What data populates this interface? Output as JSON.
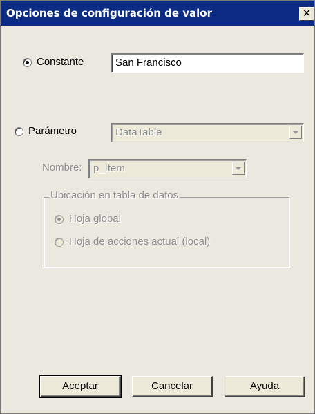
{
  "window": {
    "title": "Opciones de configuración de valor",
    "close_glyph": "✕"
  },
  "constant": {
    "label": "Constante",
    "selected": true,
    "value": "San Francisco"
  },
  "parameter": {
    "label": "Parámetro",
    "selected": false,
    "type_value": "DataTable",
    "name_label": "Nombre:",
    "name_value": "p_Item"
  },
  "location": {
    "legend": "Ubicación en tabla de datos",
    "options": [
      {
        "label": "Hoja global",
        "selected": true
      },
      {
        "label": "Hoja de acciones actual (local)",
        "selected": false
      }
    ]
  },
  "buttons": {
    "ok": "Aceptar",
    "cancel": "Cancelar",
    "help": "Ayuda"
  },
  "colors": {
    "titlebar": "#0b2c82",
    "dialog_bg": "#ece9d8",
    "disabled_text": "#8f8f8f"
  },
  "icons": [
    "close-icon",
    "dropdown-arrow-icon"
  ]
}
